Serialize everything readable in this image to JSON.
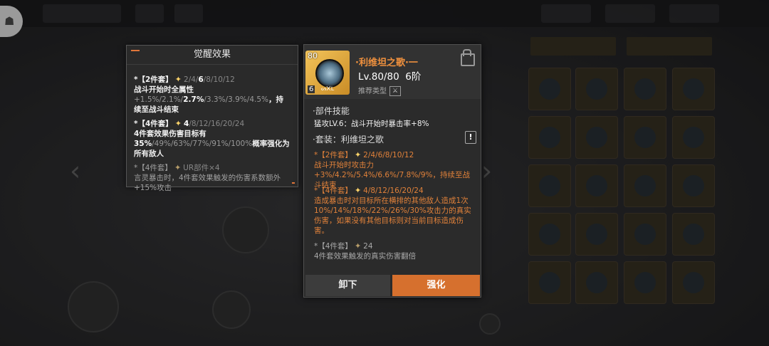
{
  "left_panel": {
    "title": "觉醒效果",
    "set2": {
      "tag": "*【2件套】",
      "levels_pre": "2/4/",
      "levels_cur": "6",
      "levels_post": "/8/10/12",
      "desc_a": "战斗开始时全属性",
      "desc_b": "+1.5%/2.1%/",
      "desc_c": "2.7%",
      "desc_d": "/3.3%/3.9%/4.5%",
      "desc_e": "，持续至战斗结束"
    },
    "set4": {
      "tag": "*【4件套】",
      "levels_cur": "4",
      "levels_post": "/8/12/16/20/24",
      "desc_a": "4件套效果伤害目标有",
      "desc_b": "35%",
      "desc_c": "/49%/63%/77%/91%/100%",
      "desc_d": "概率强化为所有敌人"
    },
    "setUR": {
      "tag": "*【4件套】",
      "levels": "UR部件×4",
      "desc": "言灵暴击时，4件套效果触发的伤害系数额外+15%攻击"
    }
  },
  "right_panel": {
    "item_level_badge": "80",
    "item_count_badge": "6",
    "item_icon_text": "ᔕ᙭ᒪ",
    "name": "·利维坦之歌·一",
    "level": "Lv.80/80",
    "rank": "6阶",
    "recommend_label": "推荐类型",
    "section_skill": "·部件技能",
    "skill_text": "猛攻LV.6：战斗开始时暴击率+8%",
    "section_set": "·套装：利维坦之歌",
    "warn_icon": "!",
    "set2": {
      "tag": "*【2件套】",
      "levels": "2/4/6/8/10/12",
      "desc": "战斗开始时攻击力+3%/4.2%/5.4%/6.6%/7.8%/9%，持续至战斗结束"
    },
    "set4": {
      "tag": "*【4件套】",
      "levels": "4/8/12/16/20/24",
      "desc": "造成暴击时对目标所在横排的其他敌人造成1次10%/14%/18%/22%/26%/30%攻击力的真实伤害，如果没有其他目标则对当前目标造成伤害。"
    },
    "setUR": {
      "tag": "*【4件套】",
      "levels": "24",
      "desc": "4件套效果触发的真实伤害翻倍"
    },
    "btn_unload": "卸下",
    "btn_upgrade": "强化"
  },
  "colors": {
    "accent": "#d6702e",
    "name": "#f0913e",
    "set_active": "#e0813a"
  }
}
